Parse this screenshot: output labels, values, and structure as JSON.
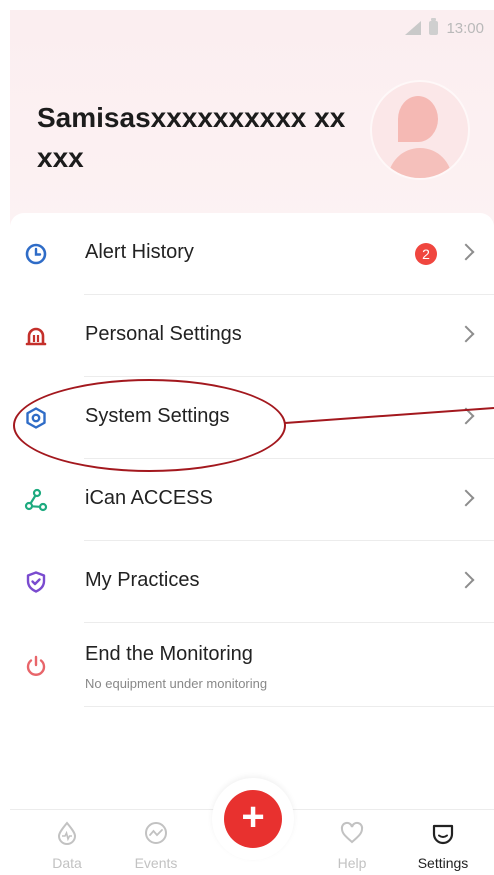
{
  "status_bar": {
    "time": "13:00"
  },
  "profile": {
    "username": "Samisasxxxxxxxxxx xxxxx"
  },
  "menu": [
    {
      "label": "Alert History",
      "badge": "2",
      "icon": "clock-icon",
      "color": "#2f6cc7"
    },
    {
      "label": "Personal Settings",
      "icon": "alarm-icon",
      "color": "#c4302b"
    },
    {
      "label": "System Settings",
      "icon": "hexagon-gear-icon",
      "color": "#2f6cc7"
    },
    {
      "label": "iCan ACCESS",
      "icon": "share-nodes-icon",
      "color": "#1daa7f"
    },
    {
      "label": "My Practices",
      "icon": "shield-check-icon",
      "color": "#7a4bcf"
    },
    {
      "label": "End the Monitoring",
      "sublabel": "No equipment under monitoring",
      "icon": "power-icon",
      "color": "#e8656a"
    }
  ],
  "tabs": [
    {
      "label": "Data",
      "icon": "drop-icon"
    },
    {
      "label": "Events",
      "icon": "trend-icon"
    },
    {
      "label": "Help",
      "icon": "heart-icon"
    },
    {
      "label": "Settings",
      "icon": "settings-icon",
      "active": true
    }
  ],
  "fab": {
    "label": "+"
  },
  "colors": {
    "accent": "#e8312f",
    "annotation": "#a3181e"
  }
}
